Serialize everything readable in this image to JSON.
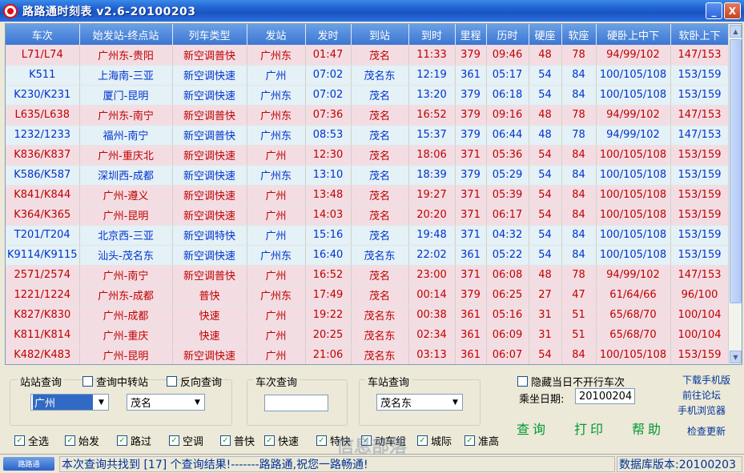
{
  "window": {
    "title": "路路通时刻表 v2.6-20100203",
    "minimize": "_",
    "close": "X"
  },
  "table": {
    "columns": [
      "车次",
      "始发站-终点站",
      "列车类型",
      "发站",
      "发时",
      "到站",
      "到时",
      "里程",
      "历时",
      "硬座",
      "软座",
      "硬卧上中下",
      "软卧上下"
    ],
    "rows": [
      {
        "style": "pink",
        "cells": [
          "L71/L74",
          "广州东-贵阳",
          "新空调普快",
          "广州东",
          "01:47",
          "茂名",
          "11:33",
          "379",
          "09:46",
          "48",
          "78",
          "94/99/102",
          "147/153"
        ]
      },
      {
        "style": "blue",
        "cells": [
          "K511",
          "上海南-三亚",
          "新空调快速",
          "广州",
          "07:02",
          "茂名东",
          "12:19",
          "361",
          "05:17",
          "54",
          "84",
          "100/105/108",
          "153/159"
        ]
      },
      {
        "style": "blue",
        "cells": [
          "K230/K231",
          "厦门-昆明",
          "新空调快速",
          "广州东",
          "07:02",
          "茂名",
          "13:20",
          "379",
          "06:18",
          "54",
          "84",
          "100/105/108",
          "153/159"
        ]
      },
      {
        "style": "pink",
        "cells": [
          "L635/L638",
          "广州东-南宁",
          "新空调普快",
          "广州东",
          "07:36",
          "茂名",
          "16:52",
          "379",
          "09:16",
          "48",
          "78",
          "94/99/102",
          "147/153"
        ]
      },
      {
        "style": "blue",
        "cells": [
          "1232/1233",
          "福州-南宁",
          "新空调普快",
          "广州东",
          "08:53",
          "茂名",
          "15:37",
          "379",
          "06:44",
          "48",
          "78",
          "94/99/102",
          "147/153"
        ]
      },
      {
        "style": "pink",
        "cells": [
          "K836/K837",
          "广州-重庆北",
          "新空调快速",
          "广州",
          "12:30",
          "茂名",
          "18:06",
          "371",
          "05:36",
          "54",
          "84",
          "100/105/108",
          "153/159"
        ]
      },
      {
        "style": "blue",
        "cells": [
          "K586/K587",
          "深圳西-成都",
          "新空调快速",
          "广州东",
          "13:10",
          "茂名",
          "18:39",
          "379",
          "05:29",
          "54",
          "84",
          "100/105/108",
          "153/159"
        ]
      },
      {
        "style": "pink",
        "cells": [
          "K841/K844",
          "广州-遵义",
          "新空调快速",
          "广州",
          "13:48",
          "茂名",
          "19:27",
          "371",
          "05:39",
          "54",
          "84",
          "100/105/108",
          "153/159"
        ]
      },
      {
        "style": "pink",
        "cells": [
          "K364/K365",
          "广州-昆明",
          "新空调快速",
          "广州",
          "14:03",
          "茂名",
          "20:20",
          "371",
          "06:17",
          "54",
          "84",
          "100/105/108",
          "153/159"
        ]
      },
      {
        "style": "blue",
        "cells": [
          "T201/T204",
          "北京西-三亚",
          "新空调特快",
          "广州",
          "15:16",
          "茂名",
          "19:48",
          "371",
          "04:32",
          "54",
          "84",
          "100/105/108",
          "153/159"
        ]
      },
      {
        "style": "blue",
        "cells": [
          "K9114/K9115",
          "汕头-茂名东",
          "新空调快速",
          "广州东",
          "16:40",
          "茂名东",
          "22:02",
          "361",
          "05:22",
          "54",
          "84",
          "100/105/108",
          "153/159"
        ]
      },
      {
        "style": "pink",
        "cells": [
          "2571/2574",
          "广州-南宁",
          "新空调普快",
          "广州",
          "16:52",
          "茂名",
          "23:00",
          "371",
          "06:08",
          "48",
          "78",
          "94/99/102",
          "147/153"
        ]
      },
      {
        "style": "pink",
        "cells": [
          "1221/1224",
          "广州东-成都",
          "普快",
          "广州东",
          "17:49",
          "茂名",
          "00:14",
          "379",
          "06:25",
          "27",
          "47",
          "61/64/66",
          "96/100"
        ]
      },
      {
        "style": "pink",
        "cells": [
          "K827/K830",
          "广州-成都",
          "快速",
          "广州",
          "19:22",
          "茂名东",
          "00:38",
          "361",
          "05:16",
          "31",
          "51",
          "65/68/70",
          "100/104"
        ]
      },
      {
        "style": "pink",
        "cells": [
          "K811/K814",
          "广州-重庆",
          "快速",
          "广州",
          "20:25",
          "茂名东",
          "02:34",
          "361",
          "06:09",
          "31",
          "51",
          "65/68/70",
          "100/104"
        ]
      },
      {
        "style": "pink",
        "cells": [
          "K482/K483",
          "广州-昆明",
          "新空调快速",
          "广州",
          "21:06",
          "茂名东",
          "03:13",
          "361",
          "06:07",
          "54",
          "84",
          "100/105/108",
          "153/159"
        ]
      }
    ]
  },
  "station_query": {
    "title": "站站查询",
    "transfer_label": "查询中转站",
    "reverse_label": "反向查询",
    "from": "广州",
    "to": "茂名"
  },
  "train_query": {
    "title": "车次查询",
    "value": ""
  },
  "stop_query": {
    "title": "车站查询",
    "value": "茂名东"
  },
  "options": {
    "hide_label": "隐藏当日不开行车次",
    "date_label": "乘坐日期:",
    "date_value": "20100204"
  },
  "actions": {
    "query": "查询",
    "print": "打印",
    "help": "帮助"
  },
  "links": {
    "download": "下载手机版",
    "forum": "前往论坛",
    "mobile": "手机浏览器",
    "update": "检查更新"
  },
  "filters": [
    {
      "label": "全选",
      "checked": true
    },
    {
      "label": "始发",
      "checked": true
    },
    {
      "label": "路过",
      "checked": true
    },
    {
      "label": "空调",
      "checked": true
    },
    {
      "label": "普快",
      "checked": true
    },
    {
      "label": "快速",
      "checked": true
    },
    {
      "label": "特快",
      "checked": true
    },
    {
      "label": "动车组",
      "checked": true
    },
    {
      "label": "城际",
      "checked": true
    },
    {
      "label": "准高",
      "checked": true
    }
  ],
  "status": {
    "logo": "路路通",
    "message": "本次查询共找到 [17] 个查询结果!-------路路通,祝您一路畅通!",
    "version": "数据库版本:20100203",
    "watermark": "信息部落"
  },
  "colors": {
    "pink_row": "#f3dde3",
    "pink_text": "#c00000",
    "blue_row": "#e4f1f7",
    "blue_text": "#0033cc",
    "header": "#3c76d2"
  }
}
